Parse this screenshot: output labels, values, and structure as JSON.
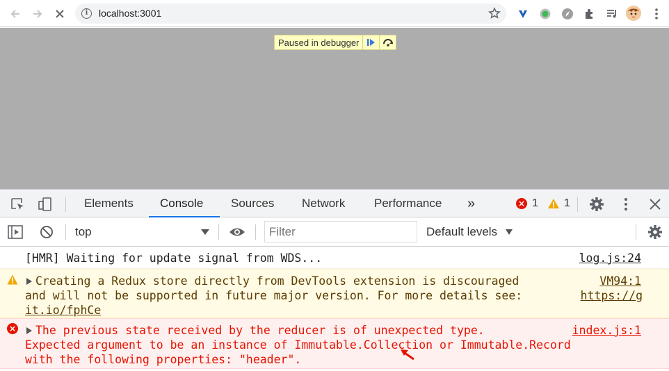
{
  "browser": {
    "url": "localhost:3001"
  },
  "viewport": {
    "paused_text": "Paused in debugger"
  },
  "devtools": {
    "tabs": [
      {
        "label": "Elements"
      },
      {
        "label": "Console"
      },
      {
        "label": "Sources"
      },
      {
        "label": "Network"
      },
      {
        "label": "Performance"
      }
    ],
    "more_tabs": "»",
    "error_count": "1",
    "warning_count": "1",
    "context": "top",
    "filter_placeholder": "Filter",
    "levels": "Default levels"
  },
  "console": {
    "messages": [
      {
        "level": "info",
        "lines": [
          "[HMR] Waiting for update signal from WDS..."
        ],
        "source": "log.js:24"
      },
      {
        "level": "warning",
        "lines": [
          "Creating a Redux store directly from DevTools extension is discouraged",
          "and will not be supported in future major version. For more details see:",
          "it.io/fphCe"
        ],
        "link_text": "https://g",
        "source": "VM94:1"
      },
      {
        "level": "error",
        "lines": [
          "The previous state received by the reducer is of unexpected type.",
          "Expected argument to be an instance of Immutable.Collection or Immutable.Record",
          "with the following properties: \"header\"."
        ],
        "source": "index.js:1"
      }
    ]
  },
  "colors": {
    "accent": "#1a73e8",
    "error": "#e51400",
    "warning_bg": "#fffbe5",
    "error_bg": "#fff0f0",
    "viewport_bg": "#adadad"
  }
}
